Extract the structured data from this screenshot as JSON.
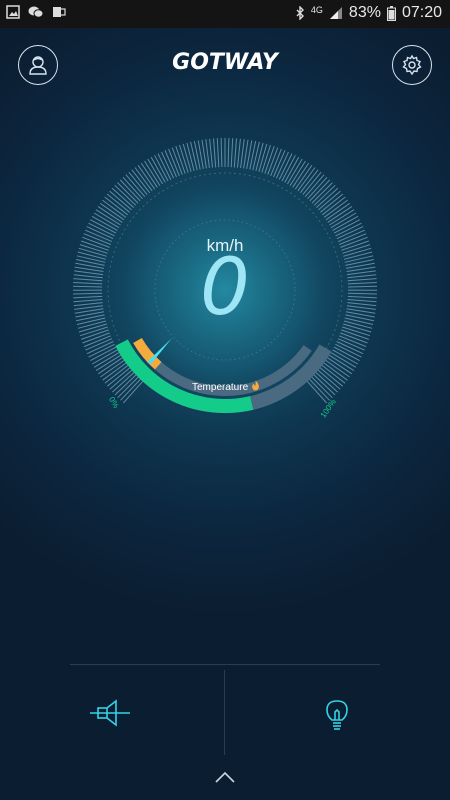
{
  "status_bar": {
    "left_icons": [
      "gallery-icon",
      "wechat-icon",
      "outlook-icon"
    ],
    "right_icons": [
      "bluetooth-icon",
      "network-4g-icon",
      "signal-icon"
    ],
    "battery": "83%",
    "time": "07:20",
    "network_label": "4G"
  },
  "header": {
    "logo": "GOTWAY",
    "profile_icon": "profile-icon",
    "settings_icon": "settings-icon"
  },
  "gauge": {
    "unit": "km/h",
    "speed": "0",
    "temperature_label": "Temperature",
    "battery_min_label": "0%",
    "battery_max_label": "100%",
    "battery_level": 0.62,
    "temperature_level": 0.12
  },
  "bottom": {
    "horn_icon": "horn-icon",
    "light_icon": "lightbulb-icon",
    "expand_icon": "chevron-up-icon"
  },
  "colors": {
    "accent": "#35d3e6",
    "battery_green": "#14cc8a",
    "temp_orange": "#f4aa3c",
    "track": "#4a6a82"
  }
}
